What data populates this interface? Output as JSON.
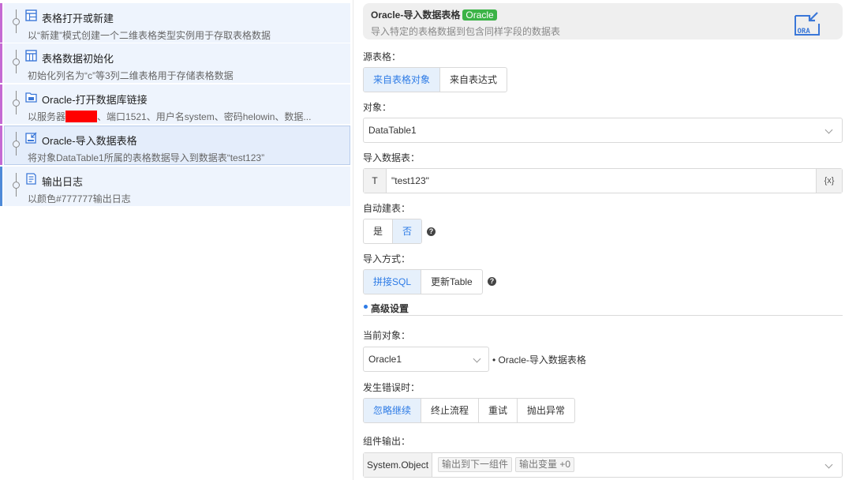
{
  "flow": {
    "steps": [
      {
        "title": "表格打开或新建",
        "desc": "以“新建”模式创建一个二维表格类型实例用于存取表格数据",
        "icon": "table-icon",
        "color": "#c46ad3"
      },
      {
        "title": "表格数据初始化",
        "desc": "初始化列名为“c”等3列二维表格用于存储表格数据",
        "icon": "table-icon",
        "color": "#c46ad3"
      },
      {
        "title": "Oracle-打开数据库链接",
        "desc_before": "以服务器",
        "desc_after": "、端口1521、用户名system、密码helowin、数据...",
        "icon": "database-icon",
        "color": "#c46ad3"
      },
      {
        "title": "Oracle-导入数据表格",
        "desc": "将对象DataTable1所属的表格数据导入到数据表“test123”",
        "icon": "import-icon",
        "color": "#c46ad3"
      },
      {
        "title": "输出日志",
        "desc": "以颜色#777777输出日志",
        "icon": "log-icon",
        "color": "#4f8ad8"
      }
    ]
  },
  "panel": {
    "title": "Oracle-导入数据表格",
    "badge": "Oracle",
    "subtitle": "导入特定的表格数据到包含同样字段的数据表",
    "logo_text": "ORA",
    "source_label": "源表格：",
    "source_options": [
      "来自表格对象",
      "来自表达式"
    ],
    "object_label": "对象：",
    "object_value": "DataTable1",
    "import_table_label": "导入数据表：",
    "import_table_type": "T",
    "import_table_value": "\"test123\"",
    "import_table_expr": "{x}",
    "auto_create_label": "自动建表：",
    "auto_create_options": [
      "是",
      "否"
    ],
    "import_mode_label": "导入方式：",
    "import_mode_options": [
      "拼接SQL",
      "更新Table"
    ],
    "advanced_title": "高级设置",
    "current_object_label": "当前对象：",
    "current_object_value": "Oracle1",
    "current_object_note": "• Oracle-导入数据表格",
    "on_error_label": "发生错误时：",
    "on_error_options": [
      "忽略继续",
      "终止流程",
      "重试",
      "抛出异常"
    ],
    "output_label": "组件输出：",
    "output_type": "System.Object",
    "output_tags": [
      "输出到下一组件",
      "输出变量 +0"
    ],
    "help_glyph": "?"
  },
  "colors": {
    "accent": "#2d7be6",
    "badge": "#3bb346",
    "redact": "#ff0000"
  }
}
